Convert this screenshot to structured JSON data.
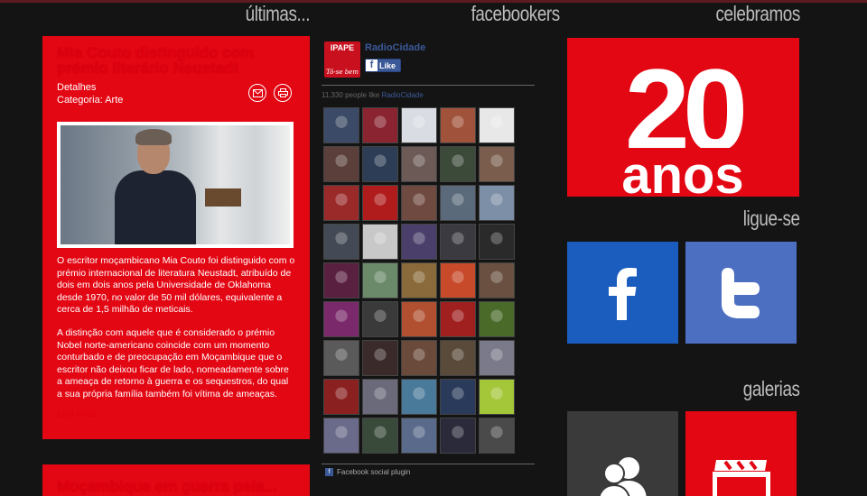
{
  "headers": {
    "ultimas": "últimas...",
    "facebookers": "facebookers",
    "celebramos": "celebramos",
    "ligue_se": "ligue-se",
    "galerias": "galerias"
  },
  "article1": {
    "title": "Mia Couto distinguido com prémio literário Neustadt",
    "detalhes": "Detalhes",
    "categoria": "Categoria: Arte",
    "paragraph1": "O escritor moçambicano Mia Couto foi distinguido com o prémio internacional de literatura Neustadt, atribuído de dois em dois anos pela Universidade de Oklahoma desde 1970, no valor de 50 mil dólares, equivalente a cerca de 1,5 milhão de meticais.",
    "paragraph2": "A distinção com aquele que é considerado o prémio Nobel norte-americano coincide com um momento conturbado e de preocupação em Moçambique que o escritor não deixou ficar de lado, nomeadamente sobre a ameaça de retorno à guerra e os sequestros, do qual a sua própria família também foi vítima de ameaças.",
    "read_more": "Leia mais..."
  },
  "article2": {
    "title": "Moçambique em guerra pela..."
  },
  "facebook": {
    "logo_text": "IPAPE",
    "logo_sub": "Tô-se bem",
    "page_name": "RadioCidade",
    "like_label": "Like",
    "count_text": "11,330 people like ",
    "count_link": "RadioCidade",
    "footer": "Facebook social plugin",
    "face_colors": [
      "#3b4a66",
      "#8a2431",
      "#d9dde3",
      "#a0523a",
      "#e8e8e8",
      "#5a3f3a",
      "#2d3d55",
      "#6b5a55",
      "#3c4a3a",
      "#7a5d4d",
      "#9a2a2a",
      "#b01c1c",
      "#6f4a40",
      "#5a6a7a",
      "#7d8fa6",
      "#444a55",
      "#c8c8c8",
      "#4a3f6a",
      "#3a3a40",
      "#2a2a2a",
      "#5a2040",
      "#6a8a6a",
      "#8a6a3a",
      "#c74a2a",
      "#6a5040",
      "#7a2a6a",
      "#3a3a3a",
      "#b05030",
      "#a02020",
      "#4a6a2a",
      "#5a5a5a",
      "#3a2a2a",
      "#6a4a3a",
      "#5a4a3a",
      "#7a7a8a",
      "#8a2020",
      "#6a6a7a",
      "#4a7a9a",
      "#2a3a5a",
      "#a4c639",
      "#6a6a8a",
      "#3a4a3a",
      "#5a6a8a",
      "#2a2a3a",
      "#4a4a4a"
    ]
  },
  "celebramos": {
    "number": "20",
    "word": "anos"
  }
}
